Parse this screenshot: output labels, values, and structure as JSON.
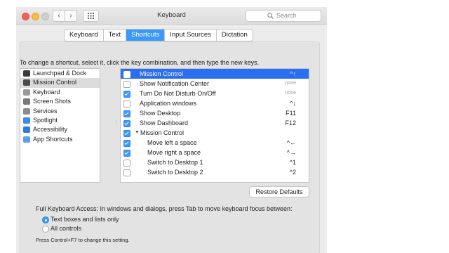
{
  "window": {
    "title": "Keyboard"
  },
  "nav": {
    "back": "‹",
    "forward": "›"
  },
  "search": {
    "placeholder": "Search"
  },
  "tabs": [
    {
      "label": "Keyboard"
    },
    {
      "label": "Text"
    },
    {
      "label": "Shortcuts",
      "active": true
    },
    {
      "label": "Input Sources"
    },
    {
      "label": "Dictation"
    }
  ],
  "instructions": "To change a shortcut, select it, click the key combination, and then type the new keys.",
  "categories": [
    {
      "label": "Launchpad & Dock",
      "icon": "launchpad-icon",
      "color": "#3a3a3a"
    },
    {
      "label": "Mission Control",
      "icon": "mission-control-icon",
      "color": "#4a4a4a",
      "selected": true
    },
    {
      "label": "Keyboard",
      "icon": "keyboard-icon",
      "color": "#9a9a9a"
    },
    {
      "label": "Screen Shots",
      "icon": "screenshot-icon",
      "color": "#7a7a7a"
    },
    {
      "label": "Services",
      "icon": "gear-icon",
      "color": "#8c8c8c"
    },
    {
      "label": "Spotlight",
      "icon": "spotlight-icon",
      "color": "#3a8ee6"
    },
    {
      "label": "Accessibility",
      "icon": "accessibility-icon",
      "color": "#2c7be5"
    },
    {
      "label": "App Shortcuts",
      "icon": "app-shortcuts-icon",
      "color": "#5aa0f0"
    }
  ],
  "shortcuts": [
    {
      "label": "Mission Control",
      "checked": false,
      "key": "^↑",
      "dim": false,
      "selected": true,
      "indent": 0
    },
    {
      "label": "Show Notification Center",
      "checked": false,
      "key": "none",
      "dim": true,
      "indent": 0
    },
    {
      "label": "Turn Do Not Disturb On/Off",
      "checked": true,
      "key": "none",
      "dim": true,
      "indent": 0
    },
    {
      "label": "Application windows",
      "checked": false,
      "key": "^↓",
      "dim": false,
      "indent": 0
    },
    {
      "label": "Show Desktop",
      "checked": true,
      "key": "F11",
      "dim": false,
      "indent": 0
    },
    {
      "label": "Show Dashboard",
      "checked": true,
      "key": "F12",
      "dim": false,
      "indent": 0
    },
    {
      "label": "Mission Control",
      "checked": true,
      "key": "",
      "dim": false,
      "indent": 0,
      "group": true
    },
    {
      "label": "Move left a space",
      "checked": true,
      "key": "^←",
      "dim": false,
      "indent": 1
    },
    {
      "label": "Move right a space",
      "checked": true,
      "key": "^→",
      "dim": false,
      "indent": 1
    },
    {
      "label": "Switch to Desktop 1",
      "checked": false,
      "key": "^1",
      "dim": false,
      "indent": 1
    },
    {
      "label": "Switch to Desktop 2",
      "checked": false,
      "key": "^2",
      "dim": false,
      "indent": 1
    }
  ],
  "restore_label": "Restore Defaults",
  "full_keyboard_access": {
    "label": "Full Keyboard Access: In windows and dialogs, press Tab to move keyboard focus between:",
    "options": [
      {
        "label": "Text boxes and lists only",
        "selected": true
      },
      {
        "label": "All controls",
        "selected": false
      }
    ],
    "hint": "Press Control+F7 to change this setting."
  }
}
